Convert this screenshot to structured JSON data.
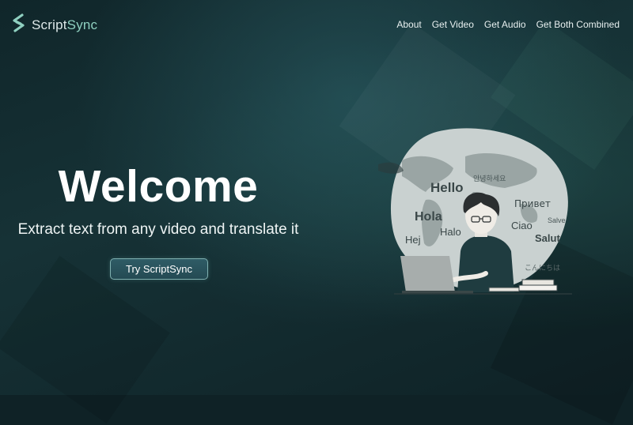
{
  "brand": {
    "name_prefix": "Script",
    "name_suffix": "Sync",
    "logo_icon": "s-logo-icon",
    "accent_color": "#8fd0c0"
  },
  "nav": {
    "items": [
      "About",
      "Get Video",
      "Get Audio",
      "Get Both Combined"
    ]
  },
  "hero": {
    "title": "Welcome",
    "subtitle": "Extract text from any video and translate it",
    "cta_label": "Try ScriptSync"
  },
  "illustration": {
    "words": [
      "Hello",
      "안녕하세요",
      "Hola",
      "Привет",
      "Salve",
      "Ciao",
      "Halo",
      "Hej",
      "Salut",
      "こんにちは"
    ]
  }
}
